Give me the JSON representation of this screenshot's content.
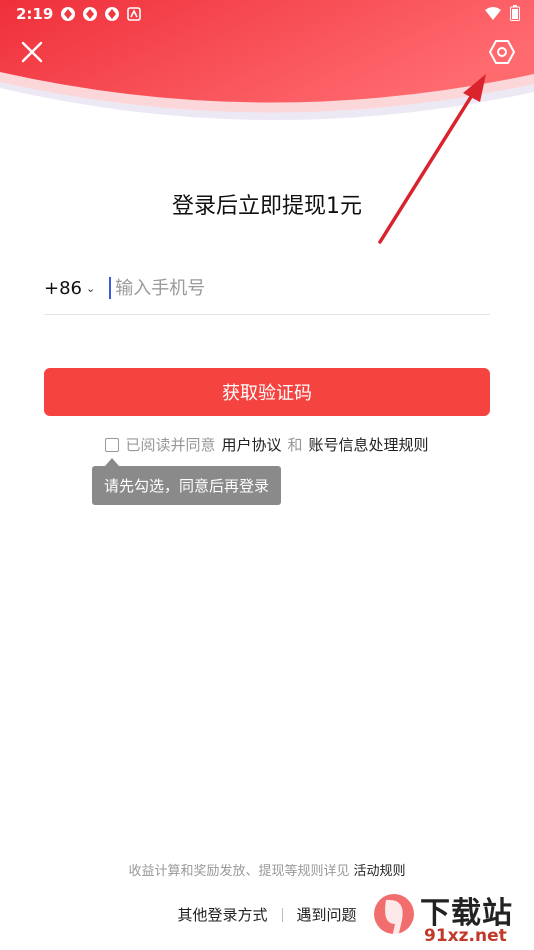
{
  "status_bar": {
    "time": "2:19",
    "icons": [
      "app-notification-icon",
      "app-notification-icon",
      "app-notification-icon",
      "android-icon"
    ],
    "right_icons": [
      "wifi-icon",
      "battery-icon"
    ]
  },
  "header": {
    "close_icon": "close-icon",
    "settings_icon": "settings-hexagon-icon",
    "gradient_colors": [
      "#f0393f",
      "#ff6b6b"
    ]
  },
  "main": {
    "title": "登录后立即提现1元",
    "country_code": "+86",
    "phone_placeholder": "输入手机号",
    "phone_value": "",
    "get_code_label": "获取验证码",
    "agree_prefix": "已阅读并同意",
    "user_agreement": "用户协议",
    "and_text": "和",
    "account_rules": "账号信息处理规则",
    "tooltip": "请先勾选，同意后再登录"
  },
  "footer": {
    "note": "收益计算和奖励发放、提现等规则详见",
    "activity_rules": "活动规则",
    "other_login": "其他登录方式",
    "problems": "遇到问题"
  },
  "watermark": {
    "top": "下载站",
    "bottom": "91xz.net",
    "logo_text": "9f"
  },
  "colors": {
    "accent": "#f5433f",
    "arrow": "#d9232d",
    "tooltip_bg": "#8a8a8a"
  }
}
